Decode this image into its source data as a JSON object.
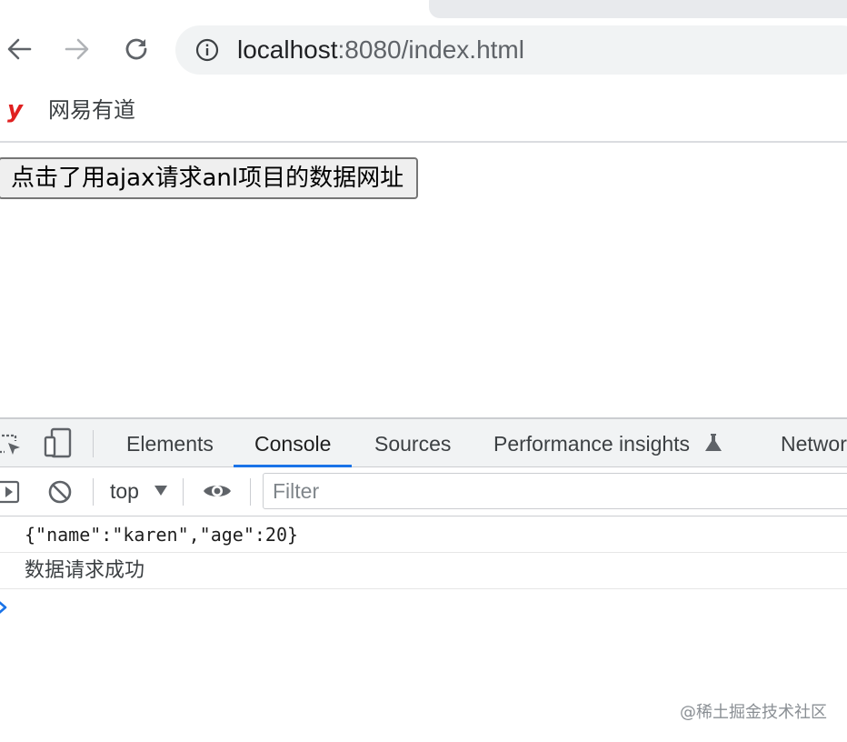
{
  "browser": {
    "back_icon": "arrow-left-icon",
    "forward_icon": "arrow-right-icon",
    "reload_icon": "reload-icon",
    "site_info_icon": "info-circle-icon",
    "url_host": "localhost",
    "url_rest": ":8080/index.html"
  },
  "bookmarks": {
    "items": [
      {
        "icon": "youdao-logo-icon",
        "icon_glyph": "y",
        "label": "网易有道"
      }
    ]
  },
  "page": {
    "button_label": "点击了用ajax请求anl项目的数据网址"
  },
  "devtools": {
    "tabs": [
      {
        "label": "Elements",
        "active": false
      },
      {
        "label": "Console",
        "active": true
      },
      {
        "label": "Sources",
        "active": false
      },
      {
        "label": "Performance insights",
        "active": false,
        "icon": "flask-icon"
      },
      {
        "label": "Network",
        "active": false
      }
    ],
    "toolbar": {
      "context": "top",
      "filter_placeholder": "Filter"
    },
    "console_messages": [
      {
        "text": "{\"name\":\"karen\",\"age\":20}"
      },
      {
        "text": "数据请求成功"
      }
    ]
  },
  "watermark": "@稀土掘金技术社区",
  "colors": {
    "accent": "#1a73e8",
    "logo": "#e02020",
    "chrome_bg": "#f1f3f4"
  }
}
